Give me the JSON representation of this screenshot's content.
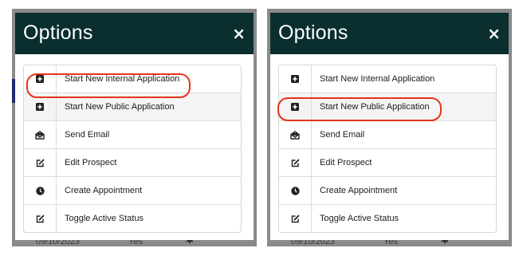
{
  "modal": {
    "title": "Options",
    "close_symbol": "×"
  },
  "menu_items": [
    {
      "label": "Start New Internal Application",
      "icon": "plus-square-icon"
    },
    {
      "label": "Start New Public Application",
      "icon": "plus-square-icon"
    },
    {
      "label": "Send Email",
      "icon": "envelope-open-icon"
    },
    {
      "label": "Edit Prospect",
      "icon": "edit-icon"
    },
    {
      "label": "Create Appointment",
      "icon": "clock-icon"
    },
    {
      "label": "Toggle Active Status",
      "icon": "edit-icon"
    }
  ],
  "background_row": {
    "date": "09/10/2023",
    "status": "Yes"
  },
  "panels": [
    {
      "highlighted_item": "Start New Internal Application"
    },
    {
      "highlighted_item": "Start New Public Application"
    }
  ],
  "colors": {
    "header": "#0b2e2f",
    "highlight": "#e8321a",
    "overlay": "#8a8a8a"
  }
}
